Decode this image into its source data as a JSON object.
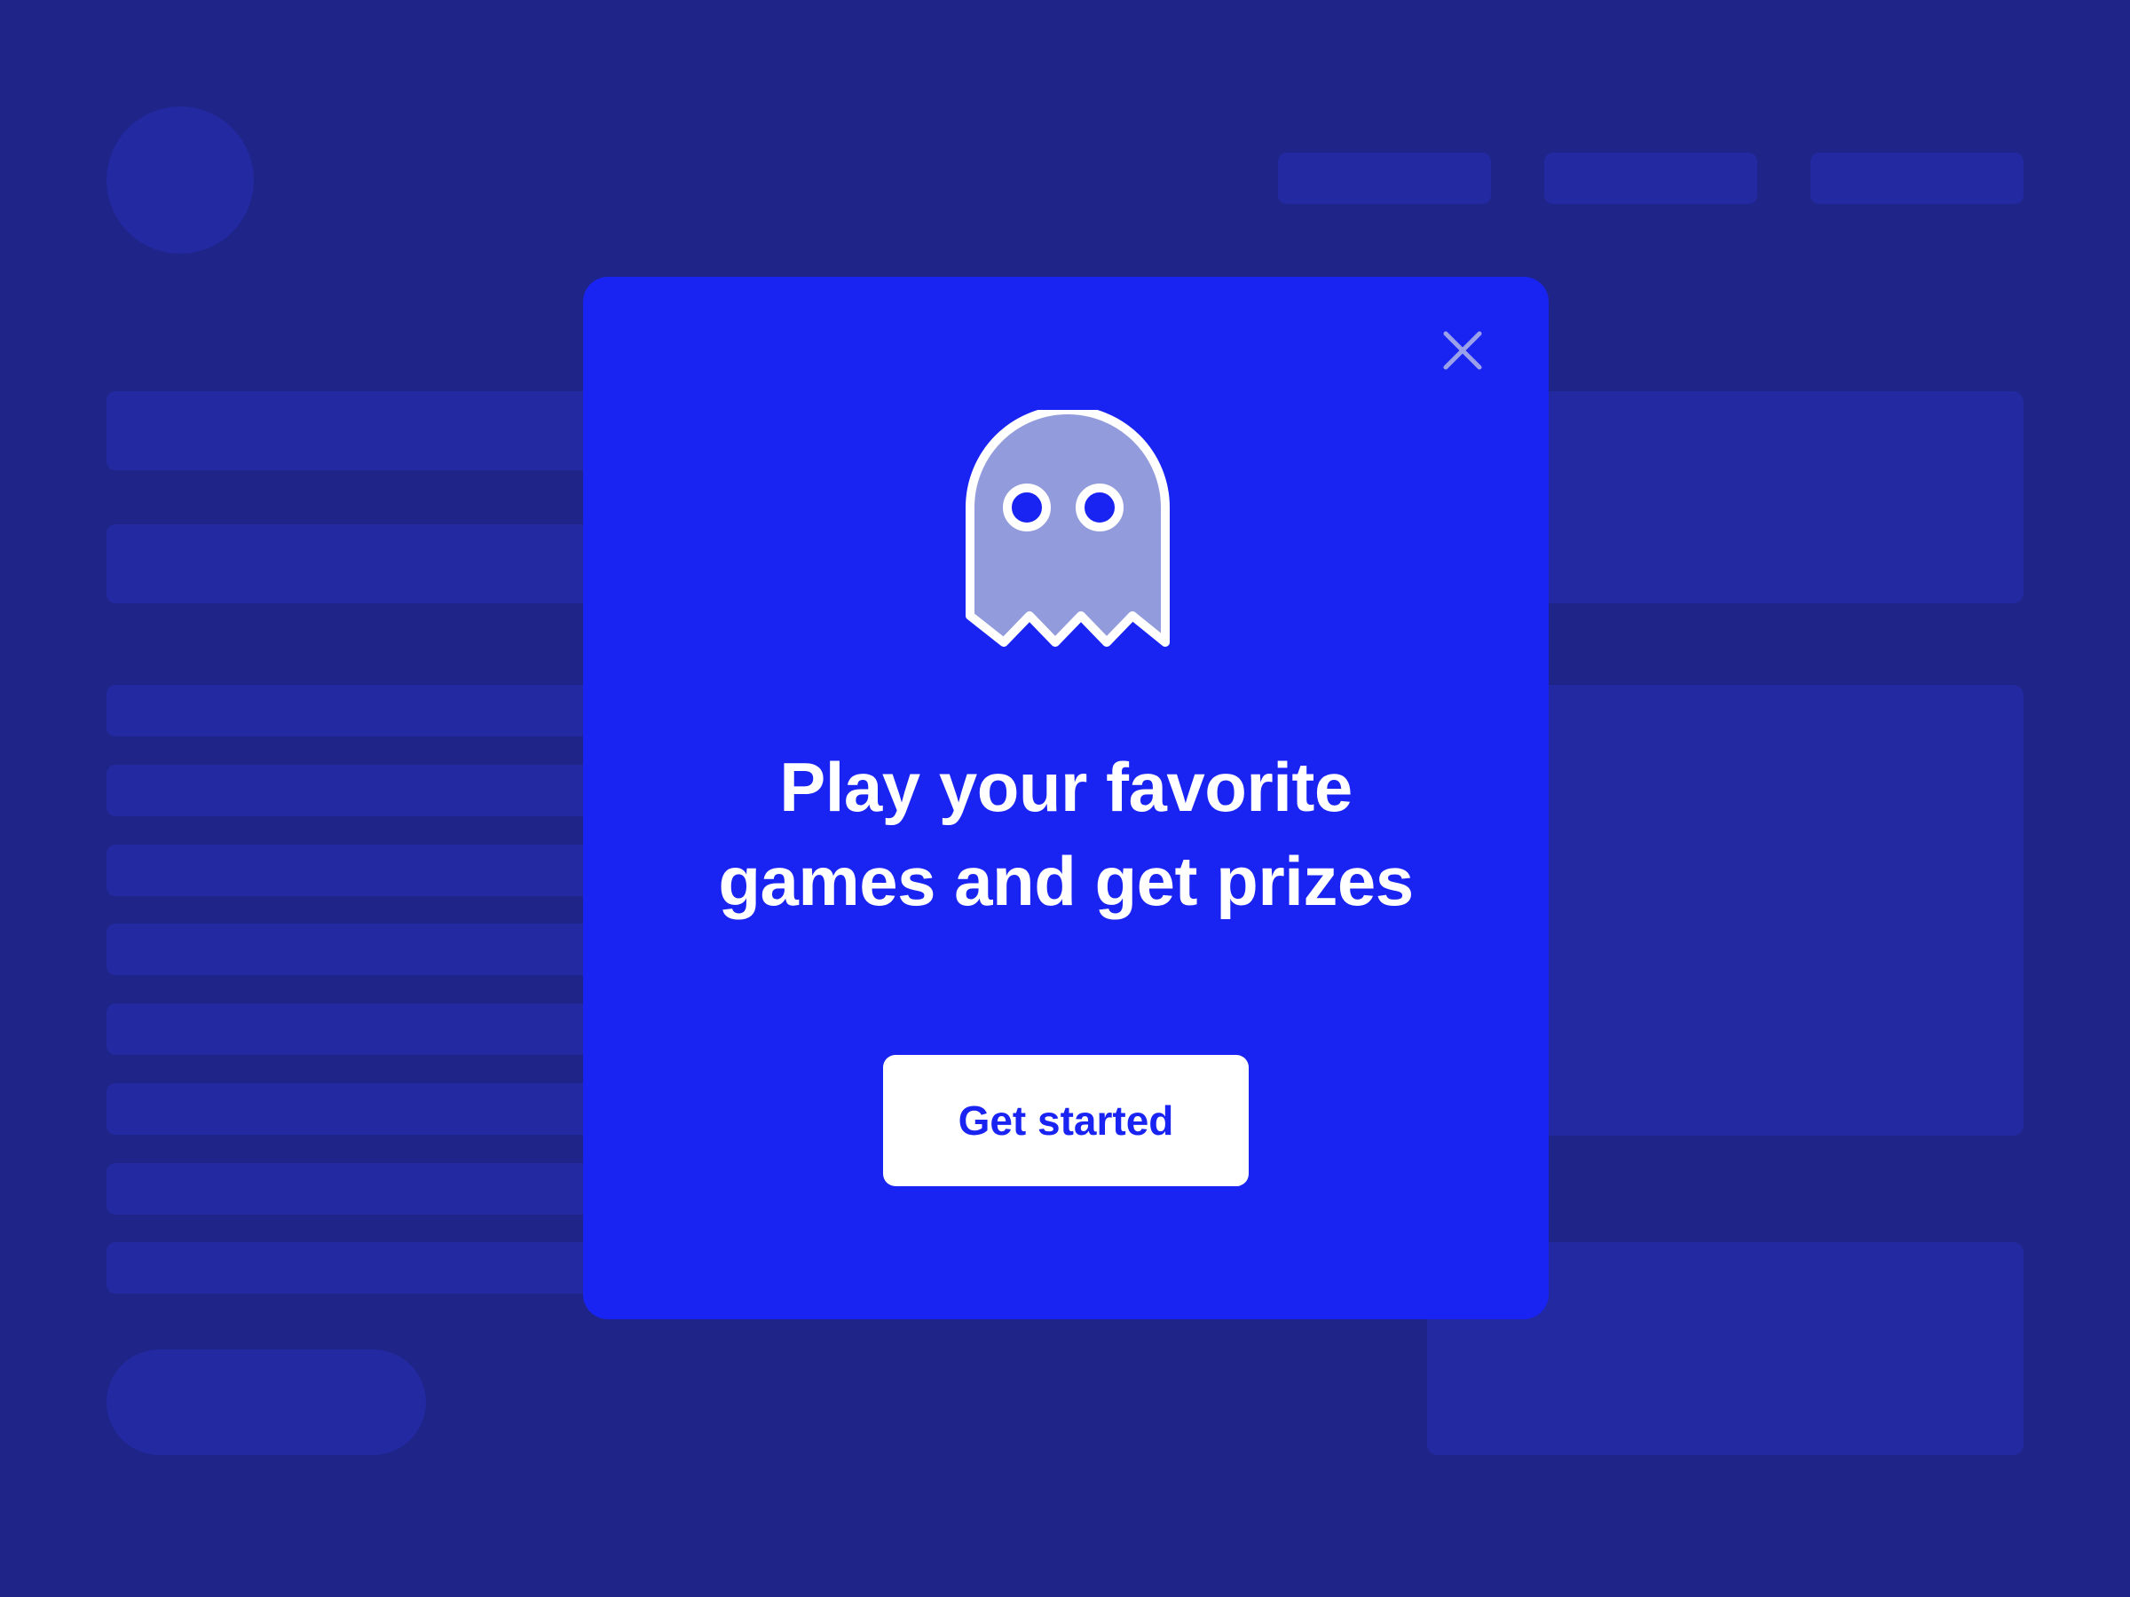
{
  "colors": {
    "page_background": "#1f2488",
    "placeholder_block": "#2329a0",
    "modal_background": "#1924f2",
    "ghost_body": "#929bdb",
    "ghost_outline": "#ffffff",
    "close_icon": "#9aa1ea",
    "button_background": "#ffffff",
    "button_text": "#1924f2"
  },
  "modal": {
    "close_icon": "close-icon",
    "illustration_icon": "ghost-icon",
    "title_line_1": "Play your favorite",
    "title_line_2": "games and get prizes",
    "cta_label": "Get started"
  }
}
